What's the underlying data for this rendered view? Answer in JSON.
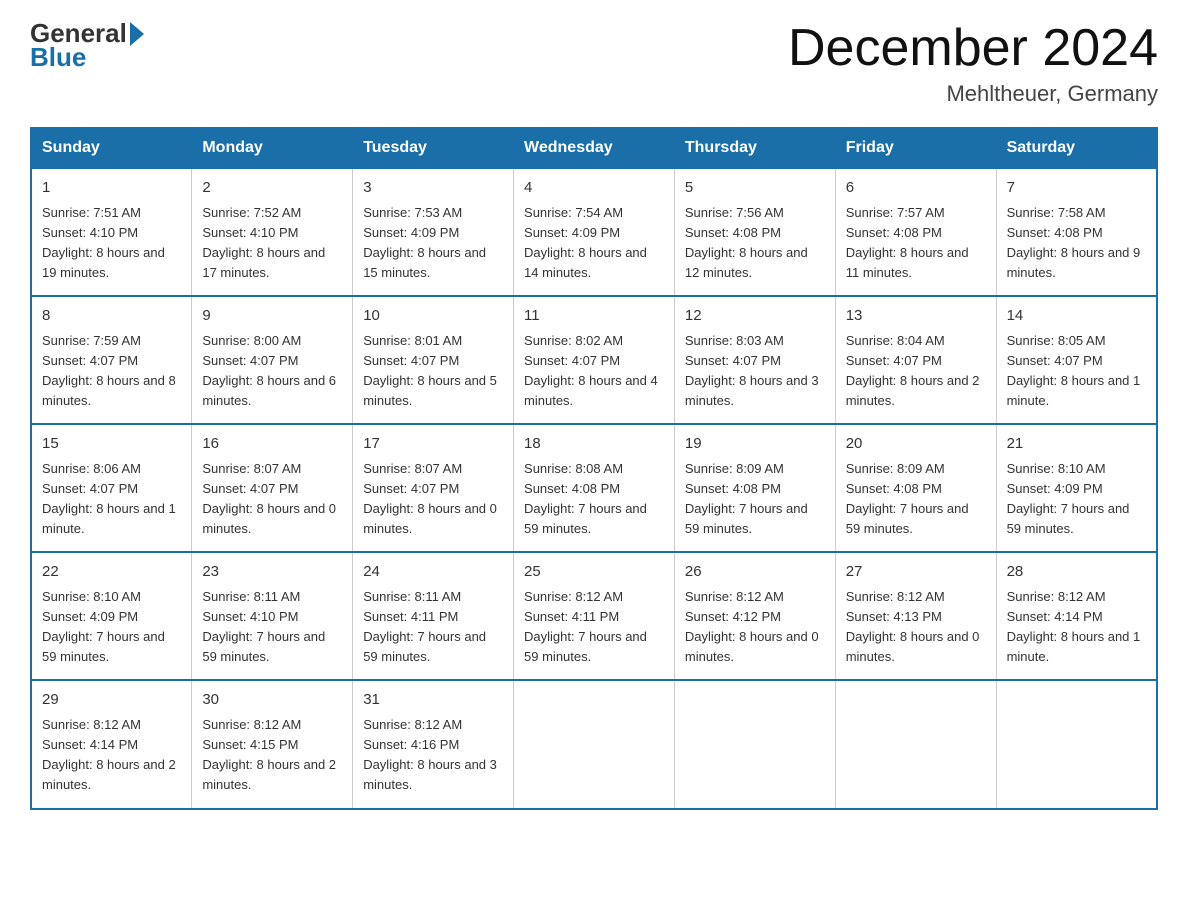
{
  "header": {
    "logo_general": "General",
    "logo_blue": "Blue",
    "month_year": "December 2024",
    "location": "Mehltheuer, Germany"
  },
  "weekdays": [
    "Sunday",
    "Monday",
    "Tuesday",
    "Wednesday",
    "Thursday",
    "Friday",
    "Saturday"
  ],
  "weeks": [
    [
      {
        "day": "1",
        "sunrise": "7:51 AM",
        "sunset": "4:10 PM",
        "daylight": "8 hours and 19 minutes."
      },
      {
        "day": "2",
        "sunrise": "7:52 AM",
        "sunset": "4:10 PM",
        "daylight": "8 hours and 17 minutes."
      },
      {
        "day": "3",
        "sunrise": "7:53 AM",
        "sunset": "4:09 PM",
        "daylight": "8 hours and 15 minutes."
      },
      {
        "day": "4",
        "sunrise": "7:54 AM",
        "sunset": "4:09 PM",
        "daylight": "8 hours and 14 minutes."
      },
      {
        "day": "5",
        "sunrise": "7:56 AM",
        "sunset": "4:08 PM",
        "daylight": "8 hours and 12 minutes."
      },
      {
        "day": "6",
        "sunrise": "7:57 AM",
        "sunset": "4:08 PM",
        "daylight": "8 hours and 11 minutes."
      },
      {
        "day": "7",
        "sunrise": "7:58 AM",
        "sunset": "4:08 PM",
        "daylight": "8 hours and 9 minutes."
      }
    ],
    [
      {
        "day": "8",
        "sunrise": "7:59 AM",
        "sunset": "4:07 PM",
        "daylight": "8 hours and 8 minutes."
      },
      {
        "day": "9",
        "sunrise": "8:00 AM",
        "sunset": "4:07 PM",
        "daylight": "8 hours and 6 minutes."
      },
      {
        "day": "10",
        "sunrise": "8:01 AM",
        "sunset": "4:07 PM",
        "daylight": "8 hours and 5 minutes."
      },
      {
        "day": "11",
        "sunrise": "8:02 AM",
        "sunset": "4:07 PM",
        "daylight": "8 hours and 4 minutes."
      },
      {
        "day": "12",
        "sunrise": "8:03 AM",
        "sunset": "4:07 PM",
        "daylight": "8 hours and 3 minutes."
      },
      {
        "day": "13",
        "sunrise": "8:04 AM",
        "sunset": "4:07 PM",
        "daylight": "8 hours and 2 minutes."
      },
      {
        "day": "14",
        "sunrise": "8:05 AM",
        "sunset": "4:07 PM",
        "daylight": "8 hours and 1 minute."
      }
    ],
    [
      {
        "day": "15",
        "sunrise": "8:06 AM",
        "sunset": "4:07 PM",
        "daylight": "8 hours and 1 minute."
      },
      {
        "day": "16",
        "sunrise": "8:07 AM",
        "sunset": "4:07 PM",
        "daylight": "8 hours and 0 minutes."
      },
      {
        "day": "17",
        "sunrise": "8:07 AM",
        "sunset": "4:07 PM",
        "daylight": "8 hours and 0 minutes."
      },
      {
        "day": "18",
        "sunrise": "8:08 AM",
        "sunset": "4:08 PM",
        "daylight": "7 hours and 59 minutes."
      },
      {
        "day": "19",
        "sunrise": "8:09 AM",
        "sunset": "4:08 PM",
        "daylight": "7 hours and 59 minutes."
      },
      {
        "day": "20",
        "sunrise": "8:09 AM",
        "sunset": "4:08 PM",
        "daylight": "7 hours and 59 minutes."
      },
      {
        "day": "21",
        "sunrise": "8:10 AM",
        "sunset": "4:09 PM",
        "daylight": "7 hours and 59 minutes."
      }
    ],
    [
      {
        "day": "22",
        "sunrise": "8:10 AM",
        "sunset": "4:09 PM",
        "daylight": "7 hours and 59 minutes."
      },
      {
        "day": "23",
        "sunrise": "8:11 AM",
        "sunset": "4:10 PM",
        "daylight": "7 hours and 59 minutes."
      },
      {
        "day": "24",
        "sunrise": "8:11 AM",
        "sunset": "4:11 PM",
        "daylight": "7 hours and 59 minutes."
      },
      {
        "day": "25",
        "sunrise": "8:12 AM",
        "sunset": "4:11 PM",
        "daylight": "7 hours and 59 minutes."
      },
      {
        "day": "26",
        "sunrise": "8:12 AM",
        "sunset": "4:12 PM",
        "daylight": "8 hours and 0 minutes."
      },
      {
        "day": "27",
        "sunrise": "8:12 AM",
        "sunset": "4:13 PM",
        "daylight": "8 hours and 0 minutes."
      },
      {
        "day": "28",
        "sunrise": "8:12 AM",
        "sunset": "4:14 PM",
        "daylight": "8 hours and 1 minute."
      }
    ],
    [
      {
        "day": "29",
        "sunrise": "8:12 AM",
        "sunset": "4:14 PM",
        "daylight": "8 hours and 2 minutes."
      },
      {
        "day": "30",
        "sunrise": "8:12 AM",
        "sunset": "4:15 PM",
        "daylight": "8 hours and 2 minutes."
      },
      {
        "day": "31",
        "sunrise": "8:12 AM",
        "sunset": "4:16 PM",
        "daylight": "8 hours and 3 minutes."
      },
      null,
      null,
      null,
      null
    ]
  ]
}
